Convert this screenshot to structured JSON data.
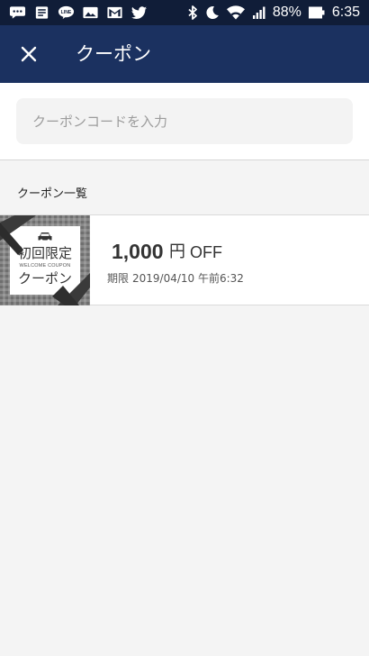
{
  "status_bar": {
    "battery": "88%",
    "time": "6:35",
    "left_icons": [
      "chat-bubble-icon",
      "notes-icon",
      "line-icon",
      "image-icon",
      "gmail-icon",
      "twitter-icon"
    ],
    "right_icons": [
      "bluetooth-icon",
      "do-not-disturb-moon-icon",
      "wifi-icon",
      "signal-icon",
      "battery-icon"
    ]
  },
  "app_bar": {
    "title": "クーポン",
    "close_icon": "close-icon"
  },
  "code_input": {
    "placeholder": "クーポンコードを入力",
    "value": ""
  },
  "coupon_list": {
    "label": "クーポン一覧",
    "items": [
      {
        "badge": {
          "line1": "初回限定",
          "line2": "WELCOME COUPON",
          "line3": "クーポン"
        },
        "amount": "1,000",
        "currency": "円",
        "suffix": "OFF",
        "expiry_label": "期限",
        "expiry": "2019/04/10 午前6:32"
      }
    ]
  },
  "colors": {
    "status_bar": "#101d38",
    "app_bar": "#1b3160",
    "background": "#f4f4f4",
    "ribbon": "#3a3a3a"
  }
}
